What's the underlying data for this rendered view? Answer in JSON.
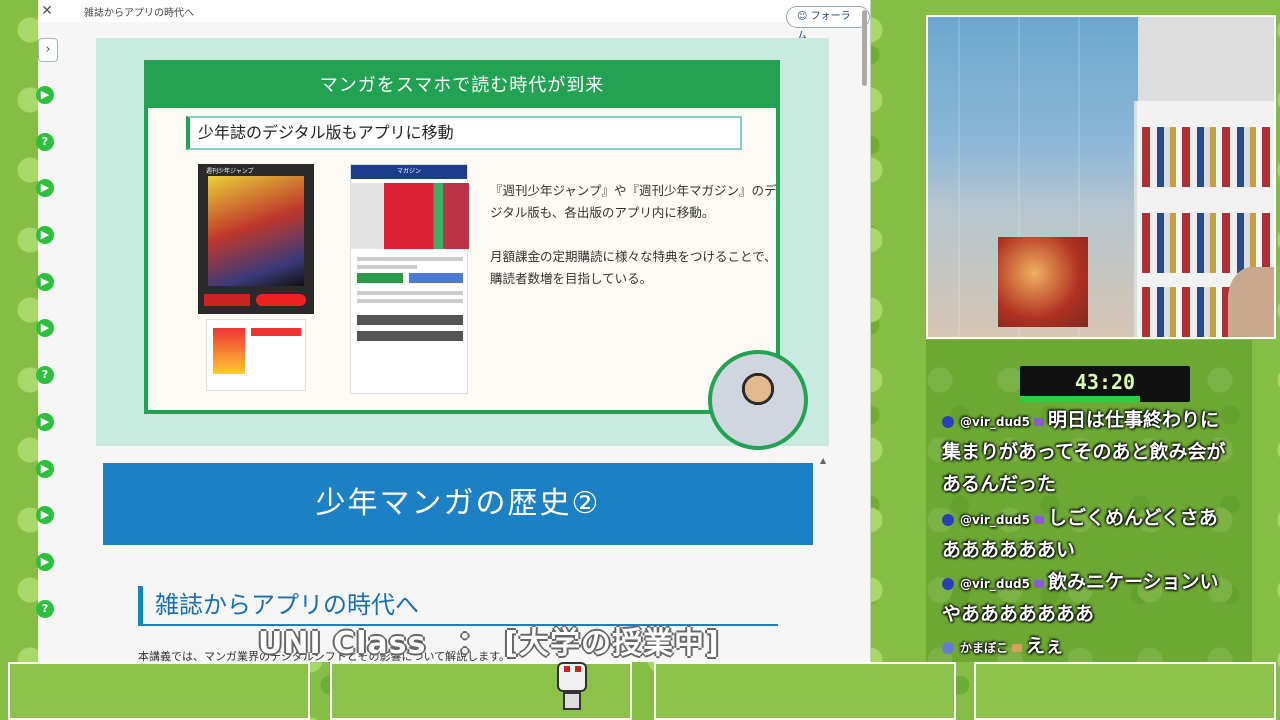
{
  "browser": {
    "breadcrumb": "雑誌からアプリの時代へ",
    "forum_button": "フォーラム"
  },
  "slide": {
    "header": "マンガをスマホで読む時代が到来",
    "subheader": "少年誌のデジタル版もアプリに移動",
    "paragraph1": "『週刊少年ジャンプ』や『週刊少年マガジン』のデジタル版も、各出版のアプリ内に移動。",
    "paragraph2": "月額課金の定期購読に様々な特典をつけることで、購読者数増を目指している。",
    "phone1_label": "週刊少年ジャンプ",
    "phone2_label": "マガジン"
  },
  "section": {
    "banner": "少年マンガの歴史②",
    "title": "雑誌からアプリの時代へ",
    "body_partial": "本講義では、マンガ業界のデジタルシフトとその影響について解説します。"
  },
  "stream": {
    "timer": "43:20",
    "caption": "UNI Class　：　[大学の授業中]"
  },
  "chat": [
    {
      "user": "@vir_dud5",
      "text": "明日は仕事終わりに　集まりがあってそのあと飲み会があるんだった"
    },
    {
      "user": "@vir_dud5",
      "text": "しごくめんどくさあああああああい"
    },
    {
      "user": "@vir_dud5",
      "text": "飲みニケーションいやあああああああ"
    },
    {
      "user": "かまぼこ",
      "text": "えぇ"
    }
  ],
  "icons": {
    "side": [
      "play-icon",
      "question-icon",
      "play-icon",
      "play-icon",
      "play-icon",
      "play-icon",
      "question-icon",
      "play-icon",
      "play-icon",
      "play-icon",
      "play-icon",
      "question-icon",
      "question-icon",
      "play-icon",
      "question-icon"
    ]
  }
}
